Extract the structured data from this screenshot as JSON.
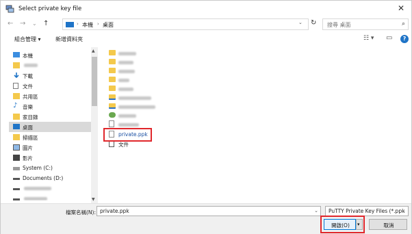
{
  "window": {
    "title": "Select private key file",
    "close_glyph": "✕"
  },
  "nav": {
    "back_glyph": "←",
    "forward_glyph": "→",
    "recent_glyph": "⌄",
    "up_glyph": "↑",
    "breadcrumb": [
      "本機",
      "桌面"
    ],
    "breadcrumb_sep": "›",
    "dropdown_glyph": "⌄",
    "refresh_glyph": "↻",
    "search_placeholder": "搜尋 桌面",
    "search_glyph": "⌕"
  },
  "toolbar": {
    "organize_label": "組合管理 ▾",
    "new_folder_label": "新增資料夾",
    "view_glyph": "☷ ▾",
    "pane_glyph": "▭",
    "help_glyph": "?"
  },
  "navpane": {
    "items": [
      {
        "label": "本機",
        "icon": "computer-icon"
      },
      {
        "label": "",
        "icon": "folder-icon"
      },
      {
        "label": "下載",
        "icon": "download-icon"
      },
      {
        "label": "文件",
        "icon": "document-icon"
      },
      {
        "label": "共用區",
        "icon": "folder-icon"
      },
      {
        "label": "音樂",
        "icon": "music-icon"
      },
      {
        "label": "家目錄",
        "icon": "folder-icon"
      },
      {
        "label": "桌面",
        "icon": "desktop-icon"
      },
      {
        "label": "掃描區",
        "icon": "folder-icon"
      },
      {
        "label": "圖片",
        "icon": "pictures-icon"
      },
      {
        "label": "影片",
        "icon": "video-icon"
      },
      {
        "label": "System (C:)",
        "icon": "drive-icon"
      },
      {
        "label": "Documents (D:)",
        "icon": "drive-icon"
      },
      {
        "label": "",
        "icon": "drive-icon"
      },
      {
        "label": "",
        "icon": "drive-icon"
      }
    ],
    "selected_index": 7,
    "scroll_up_glyph": "▲",
    "scroll_down_glyph": "▼"
  },
  "files": {
    "items": [
      {
        "label": "",
        "icon": "folder-icon"
      },
      {
        "label": "",
        "icon": "folder-icon"
      },
      {
        "label": "",
        "icon": "folder-icon"
      },
      {
        "label": "",
        "icon": "folder-icon"
      },
      {
        "label": "",
        "icon": "folder-icon"
      },
      {
        "label": "",
        "icon": "shortcut-icon"
      },
      {
        "label": "",
        "icon": "shortcut-icon"
      },
      {
        "label": "",
        "icon": "shortcut-icon"
      },
      {
        "label": "",
        "icon": "document-icon"
      },
      {
        "label": "private.ppk",
        "icon": "ppk-file-icon"
      },
      {
        "label": "文件",
        "icon": "document-icon"
      }
    ],
    "highlighted_index": 9
  },
  "bottom": {
    "filename_label": "檔案名稱(N):",
    "filename_value": "private.ppk",
    "filename_dd": "⌄",
    "filetype_value": "PuTTY Private Key Files (*.ppk",
    "filetype_dd": "⌄",
    "open_label": "開啟(O)",
    "split_glyph": "▾",
    "cancel_label": "取消"
  },
  "colors": {
    "accent": "#0078d7",
    "highlight": "#e0262b",
    "folder": "#f4c94c"
  }
}
